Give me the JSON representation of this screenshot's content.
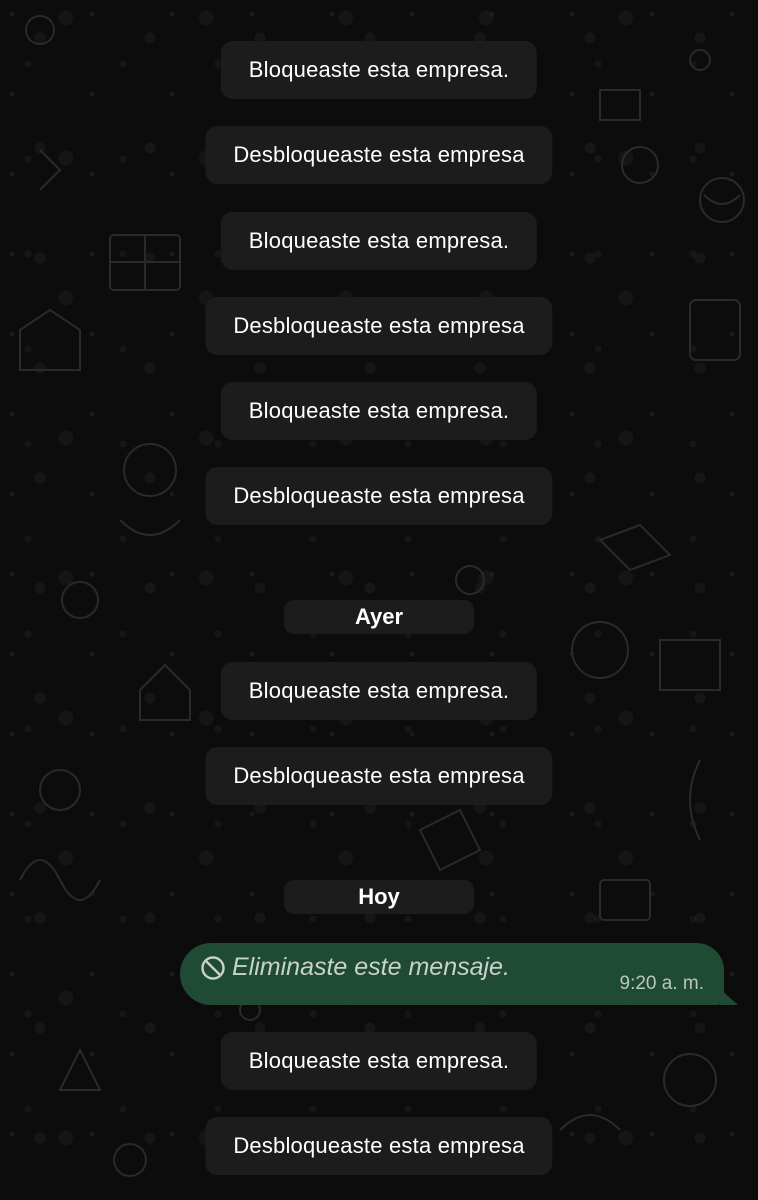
{
  "conversation": {
    "system_messages": {
      "blocked": "Bloqueaste esta empresa.",
      "unblocked": "Desbloqueaste esta empresa"
    },
    "date_separators": {
      "yesterday": "Ayer",
      "today": "Hoy"
    },
    "outgoing_message": {
      "text": "Eliminaste este mensaje.",
      "time": "9:20 a. m.",
      "icon": "prohibited-icon",
      "bubble_color": "#1f4a34"
    }
  },
  "theme": {
    "background": "#0c0c0c",
    "system_bubble": "#1c1c1d",
    "text": "#ffffff"
  }
}
